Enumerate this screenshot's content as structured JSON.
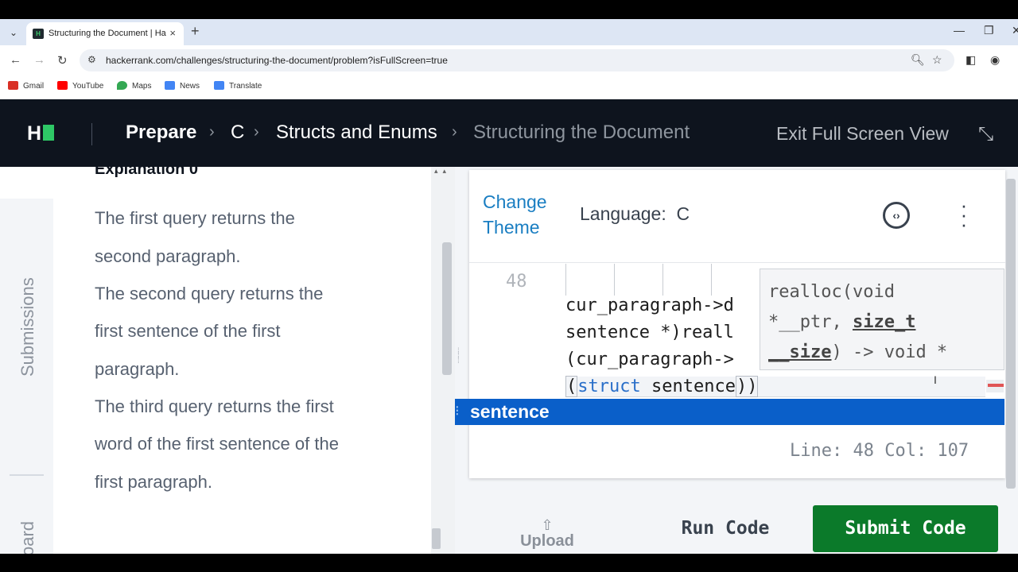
{
  "browser": {
    "tab_title": "Structuring the Document | Hac",
    "tab_favicon": "H",
    "url": "hackerrank.com/challenges/structuring-the-document/problem?isFullScreen=true",
    "bookmarks": [
      {
        "label": "Gmail",
        "color": "#d93025"
      },
      {
        "label": "YouTube",
        "color": "#ff0000"
      },
      {
        "label": "Maps",
        "color": "#34a853"
      },
      {
        "label": "News",
        "color": "#4285f4"
      },
      {
        "label": "Translate",
        "color": "#4285f4"
      }
    ]
  },
  "header": {
    "logo": "H",
    "breadcrumbs": [
      {
        "label": "Prepare"
      },
      {
        "label": "C"
      },
      {
        "label": "Structs and Enums"
      },
      {
        "label": "Structuring the Document"
      }
    ],
    "exit_fullscreen": "Exit Full Screen View"
  },
  "problem": {
    "explanation_title": "Explanation 0",
    "lines": [
      "The first query returns the",
      "second paragraph.",
      "The second query returns the",
      "first sentence of the first",
      "paragraph.",
      "The third query returns the first",
      "word of the first sentence of the",
      "first paragraph."
    ],
    "rail": {
      "submissions": "Submissions",
      "leaderboard": "oard"
    }
  },
  "editor": {
    "change_theme": "Change Theme",
    "language_label": "Language:",
    "language_value": "C",
    "line_number": "48",
    "code": {
      "line1": "cur_paragraph->d",
      "line2": "sentence *)reall",
      "line3": "(cur_paragraph->",
      "line4_open": "(",
      "line4_kw": "struct",
      "line4_rest": " sentence",
      "line4_close": "))"
    },
    "tooltip": {
      "line1": "realloc(void",
      "line2_a": "*__ptr, ",
      "line2_b": "size_t",
      "line3_a": "__size",
      "line3_b": ") -> void *"
    },
    "suggestion": "sentence",
    "status": "Line: 48 Col: 107"
  },
  "actions": {
    "upload": "Upload",
    "run": "Run Code",
    "submit": "Submit Code"
  },
  "colors": {
    "header_bg": "#0e141e",
    "brand_green": "#2ec866",
    "submit_green": "#0b7a2a",
    "link_blue": "#1a7ec2",
    "suggest_blue": "#0a5fc9"
  }
}
